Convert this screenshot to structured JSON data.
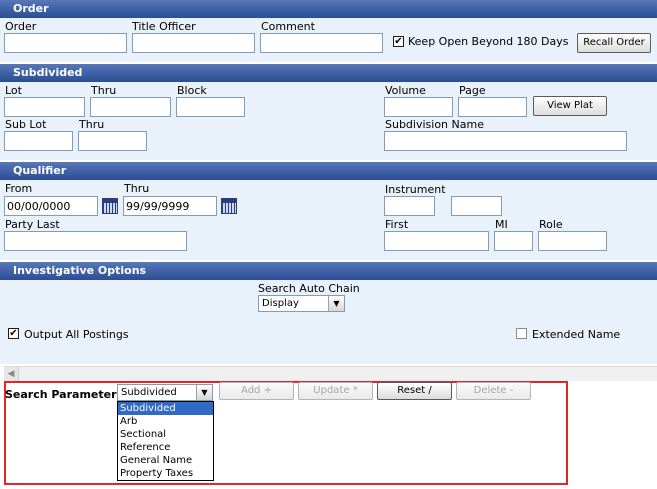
{
  "order": {
    "header": "Order",
    "order_label": "Order",
    "title_officer_label": "Title Officer",
    "comment_label": "Comment",
    "keep_open_label": "Keep Open Beyond 180 Days",
    "keep_open_checked": true,
    "recall_order_button": "Recall Order"
  },
  "subdivided": {
    "header": "Subdivided",
    "lot_label": "Lot",
    "thru_label": "Thru",
    "block_label": "Block",
    "volume_label": "Volume",
    "page_label": "Page",
    "view_plat_button": "View Plat",
    "sub_lot_label": "Sub Lot",
    "sub_thru_label": "Thru",
    "subdivision_name_label": "Subdivision Name"
  },
  "qualifier": {
    "header": "Qualifier",
    "from_label": "From",
    "from_value": "00/00/0000",
    "thru_label": "Thru",
    "thru_value": "99/99/9999",
    "instrument_label": "Instrument",
    "party_last_label": "Party Last",
    "first_label": "First",
    "mi_label": "MI",
    "role_label": "Role"
  },
  "investigative": {
    "header": "Investigative Options",
    "search_auto_chain_label": "Search Auto Chain",
    "search_auto_chain_value": "Display",
    "output_all_postings_label": "Output All Postings",
    "output_all_postings_checked": true,
    "extended_name_label": "Extended Name",
    "extended_name_checked": false
  },
  "search_params": {
    "label": "Search Parameters",
    "selected": "Subdivided",
    "options": [
      "Subdivided",
      "Arb",
      "Sectional",
      "Reference",
      "General Name",
      "Property Taxes"
    ],
    "add_button": "Add +",
    "update_button": "Update *",
    "reset_button": "Reset /",
    "delete_button": "Delete -"
  },
  "colors": {
    "header_bg": "#2b4d95",
    "section_bg": "#e9f1fb",
    "highlight_border": "#e0262b",
    "selected_option": "#316ac5"
  }
}
